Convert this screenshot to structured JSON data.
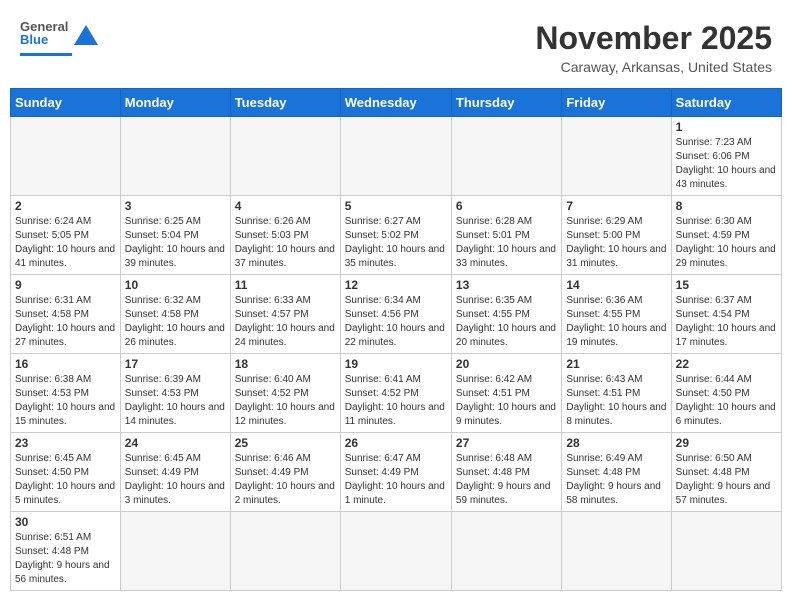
{
  "header": {
    "logo_text_normal": "General",
    "logo_text_colored": "Blue",
    "month_title": "November 2025",
    "location": "Caraway, Arkansas, United States"
  },
  "calendar": {
    "days_of_week": [
      "Sunday",
      "Monday",
      "Tuesday",
      "Wednesday",
      "Thursday",
      "Friday",
      "Saturday"
    ],
    "weeks": [
      [
        {
          "day": "",
          "info": ""
        },
        {
          "day": "",
          "info": ""
        },
        {
          "day": "",
          "info": ""
        },
        {
          "day": "",
          "info": ""
        },
        {
          "day": "",
          "info": ""
        },
        {
          "day": "",
          "info": ""
        },
        {
          "day": "1",
          "info": "Sunrise: 7:23 AM\nSunset: 6:06 PM\nDaylight: 10 hours and 43 minutes."
        }
      ],
      [
        {
          "day": "2",
          "info": "Sunrise: 6:24 AM\nSunset: 5:05 PM\nDaylight: 10 hours and 41 minutes."
        },
        {
          "day": "3",
          "info": "Sunrise: 6:25 AM\nSunset: 5:04 PM\nDaylight: 10 hours and 39 minutes."
        },
        {
          "day": "4",
          "info": "Sunrise: 6:26 AM\nSunset: 5:03 PM\nDaylight: 10 hours and 37 minutes."
        },
        {
          "day": "5",
          "info": "Sunrise: 6:27 AM\nSunset: 5:02 PM\nDaylight: 10 hours and 35 minutes."
        },
        {
          "day": "6",
          "info": "Sunrise: 6:28 AM\nSunset: 5:01 PM\nDaylight: 10 hours and 33 minutes."
        },
        {
          "day": "7",
          "info": "Sunrise: 6:29 AM\nSunset: 5:00 PM\nDaylight: 10 hours and 31 minutes."
        },
        {
          "day": "8",
          "info": "Sunrise: 6:30 AM\nSunset: 4:59 PM\nDaylight: 10 hours and 29 minutes."
        }
      ],
      [
        {
          "day": "9",
          "info": "Sunrise: 6:31 AM\nSunset: 4:58 PM\nDaylight: 10 hours and 27 minutes."
        },
        {
          "day": "10",
          "info": "Sunrise: 6:32 AM\nSunset: 4:58 PM\nDaylight: 10 hours and 26 minutes."
        },
        {
          "day": "11",
          "info": "Sunrise: 6:33 AM\nSunset: 4:57 PM\nDaylight: 10 hours and 24 minutes."
        },
        {
          "day": "12",
          "info": "Sunrise: 6:34 AM\nSunset: 4:56 PM\nDaylight: 10 hours and 22 minutes."
        },
        {
          "day": "13",
          "info": "Sunrise: 6:35 AM\nSunset: 4:55 PM\nDaylight: 10 hours and 20 minutes."
        },
        {
          "day": "14",
          "info": "Sunrise: 6:36 AM\nSunset: 4:55 PM\nDaylight: 10 hours and 19 minutes."
        },
        {
          "day": "15",
          "info": "Sunrise: 6:37 AM\nSunset: 4:54 PM\nDaylight: 10 hours and 17 minutes."
        }
      ],
      [
        {
          "day": "16",
          "info": "Sunrise: 6:38 AM\nSunset: 4:53 PM\nDaylight: 10 hours and 15 minutes."
        },
        {
          "day": "17",
          "info": "Sunrise: 6:39 AM\nSunset: 4:53 PM\nDaylight: 10 hours and 14 minutes."
        },
        {
          "day": "18",
          "info": "Sunrise: 6:40 AM\nSunset: 4:52 PM\nDaylight: 10 hours and 12 minutes."
        },
        {
          "day": "19",
          "info": "Sunrise: 6:41 AM\nSunset: 4:52 PM\nDaylight: 10 hours and 11 minutes."
        },
        {
          "day": "20",
          "info": "Sunrise: 6:42 AM\nSunset: 4:51 PM\nDaylight: 10 hours and 9 minutes."
        },
        {
          "day": "21",
          "info": "Sunrise: 6:43 AM\nSunset: 4:51 PM\nDaylight: 10 hours and 8 minutes."
        },
        {
          "day": "22",
          "info": "Sunrise: 6:44 AM\nSunset: 4:50 PM\nDaylight: 10 hours and 6 minutes."
        }
      ],
      [
        {
          "day": "23",
          "info": "Sunrise: 6:45 AM\nSunset: 4:50 PM\nDaylight: 10 hours and 5 minutes."
        },
        {
          "day": "24",
          "info": "Sunrise: 6:45 AM\nSunset: 4:49 PM\nDaylight: 10 hours and 3 minutes."
        },
        {
          "day": "25",
          "info": "Sunrise: 6:46 AM\nSunset: 4:49 PM\nDaylight: 10 hours and 2 minutes."
        },
        {
          "day": "26",
          "info": "Sunrise: 6:47 AM\nSunset: 4:49 PM\nDaylight: 10 hours and 1 minute."
        },
        {
          "day": "27",
          "info": "Sunrise: 6:48 AM\nSunset: 4:48 PM\nDaylight: 9 hours and 59 minutes."
        },
        {
          "day": "28",
          "info": "Sunrise: 6:49 AM\nSunset: 4:48 PM\nDaylight: 9 hours and 58 minutes."
        },
        {
          "day": "29",
          "info": "Sunrise: 6:50 AM\nSunset: 4:48 PM\nDaylight: 9 hours and 57 minutes."
        }
      ],
      [
        {
          "day": "30",
          "info": "Sunrise: 6:51 AM\nSunset: 4:48 PM\nDaylight: 9 hours and 56 minutes."
        },
        {
          "day": "",
          "info": ""
        },
        {
          "day": "",
          "info": ""
        },
        {
          "day": "",
          "info": ""
        },
        {
          "day": "",
          "info": ""
        },
        {
          "day": "",
          "info": ""
        },
        {
          "day": "",
          "info": ""
        }
      ]
    ]
  }
}
